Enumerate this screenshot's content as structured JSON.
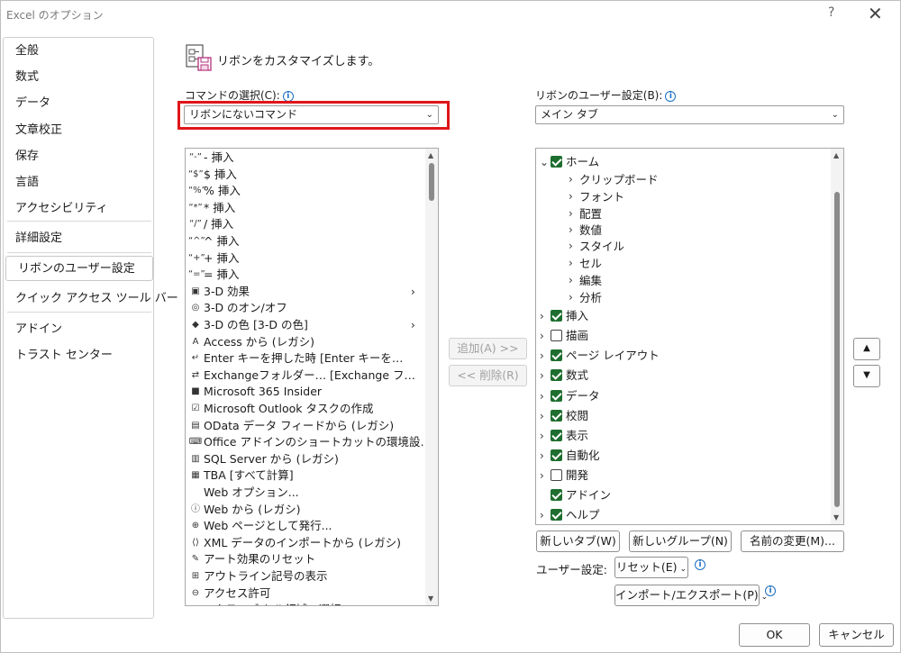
{
  "window": {
    "title": "Excel のオプション",
    "help": "?",
    "close": "✕"
  },
  "nav": {
    "items": [
      {
        "label": "全般"
      },
      {
        "label": "数式"
      },
      {
        "label": "データ"
      },
      {
        "label": "文章校正"
      },
      {
        "label": "保存"
      },
      {
        "label": "言語"
      },
      {
        "label": "アクセシビリティ"
      },
      {
        "label": "詳細設定"
      },
      {
        "label": "リボンのユーザー設定",
        "selected": true
      },
      {
        "label": "クイック アクセス ツール バー"
      },
      {
        "label": "アドイン"
      },
      {
        "label": "トラスト センター"
      }
    ]
  },
  "header": {
    "text": "リボンをカスタマイズします。"
  },
  "commands": {
    "label": "コマンドの選択(C):",
    "selected": "リボンにないコマンド",
    "items": [
      {
        "icon": "“-”",
        "label": "- 挿入"
      },
      {
        "icon": "“$”",
        "label": "$ 挿入"
      },
      {
        "icon": "“%”",
        "label": "% 挿入"
      },
      {
        "icon": "“*”",
        "label": "* 挿入"
      },
      {
        "icon": "“/”",
        "label": "/ 挿入"
      },
      {
        "icon": "“^”",
        "label": "^ 挿入"
      },
      {
        "icon": "“+”",
        "label": "+ 挿入"
      },
      {
        "icon": "“=”",
        "label": "= 挿入"
      },
      {
        "icon": "▣",
        "label": "3-D 効果",
        "submenu": true
      },
      {
        "icon": "◎",
        "label": "3-D のオン/オフ"
      },
      {
        "icon": "◆",
        "label": "3-D の色 [3-D の色]",
        "submenu": true
      },
      {
        "icon": "A",
        "label": "Access から (レガシ)"
      },
      {
        "icon": "↵",
        "label": "Enter キーを押した時 [Enter キーを…"
      },
      {
        "icon": "⇄",
        "label": "Exchangeフォルダー… [Exchange フ…"
      },
      {
        "icon": "■",
        "label": "Microsoft 365 Insider"
      },
      {
        "icon": "☑",
        "label": "Microsoft Outlook タスクの作成"
      },
      {
        "icon": "▤",
        "label": "OData データ フィードから (レガシ)"
      },
      {
        "icon": "⌨",
        "label": "Office アドインのショートカットの環境設…"
      },
      {
        "icon": "▥",
        "label": "SQL Server から (レガシ)"
      },
      {
        "icon": "▦",
        "label": "TBA [すべて計算]"
      },
      {
        "icon": "",
        "label": "Web オプション..."
      },
      {
        "icon": "ⓘ",
        "label": "Web から (レガシ)"
      },
      {
        "icon": "⊕",
        "label": "Web ページとして発行..."
      },
      {
        "icon": "⟨⟩",
        "label": "XML データのインポートから (レガシ)"
      },
      {
        "icon": "✎",
        "label": "アート効果のリセット"
      },
      {
        "icon": "⊞",
        "label": "アウトライン記号の表示"
      },
      {
        "icon": "⊖",
        "label": "アクセス許可"
      },
      {
        "icon": "▢",
        "label": "アクティブ セル領域の選択"
      }
    ]
  },
  "ribbon": {
    "label": "リボンのユーザー設定(B):",
    "selected": "メイン タブ",
    "tree": [
      {
        "label": "ホーム",
        "level": 0,
        "expanded": true,
        "checked": true,
        "hasCheckbox": true
      },
      {
        "label": "クリップボード",
        "level": 1,
        "expanded": false,
        "hasCheckbox": false
      },
      {
        "label": "フォント",
        "level": 1,
        "expanded": false,
        "hasCheckbox": false
      },
      {
        "label": "配置",
        "level": 1,
        "expanded": false,
        "hasCheckbox": false
      },
      {
        "label": "数値",
        "level": 1,
        "expanded": false,
        "hasCheckbox": false
      },
      {
        "label": "スタイル",
        "level": 1,
        "expanded": false,
        "hasCheckbox": false
      },
      {
        "label": "セル",
        "level": 1,
        "expanded": false,
        "hasCheckbox": false
      },
      {
        "label": "編集",
        "level": 1,
        "expanded": false,
        "hasCheckbox": false
      },
      {
        "label": "分析",
        "level": 1,
        "expanded": false,
        "hasCheckbox": false
      },
      {
        "label": "挿入",
        "level": 0,
        "expanded": false,
        "checked": true,
        "hasCheckbox": true
      },
      {
        "label": "描画",
        "level": 0,
        "expanded": false,
        "checked": false,
        "hasCheckbox": true
      },
      {
        "label": "ページ レイアウト",
        "level": 0,
        "expanded": false,
        "checked": true,
        "hasCheckbox": true
      },
      {
        "label": "数式",
        "level": 0,
        "expanded": false,
        "checked": true,
        "hasCheckbox": true
      },
      {
        "label": "データ",
        "level": 0,
        "expanded": false,
        "checked": true,
        "hasCheckbox": true
      },
      {
        "label": "校閲",
        "level": 0,
        "expanded": false,
        "checked": true,
        "hasCheckbox": true
      },
      {
        "label": "表示",
        "level": 0,
        "expanded": false,
        "checked": true,
        "hasCheckbox": true
      },
      {
        "label": "自動化",
        "level": 0,
        "expanded": false,
        "checked": true,
        "hasCheckbox": true
      },
      {
        "label": "開発",
        "level": 0,
        "expanded": false,
        "checked": false,
        "hasCheckbox": true
      },
      {
        "label": "アドイン",
        "level": 0,
        "expanded": null,
        "checked": true,
        "hasCheckbox": true
      },
      {
        "label": "ヘルプ",
        "level": 0,
        "expanded": false,
        "checked": true,
        "hasCheckbox": true
      }
    ]
  },
  "buttons": {
    "add": "追加(A) >>",
    "remove": "<< 削除(R)",
    "new_tab": "新しいタブ(W)",
    "new_group": "新しいグループ(N)",
    "rename": "名前の変更(M)...",
    "custom_label": "ユーザー設定:",
    "reset": "リセット(E)",
    "import_export": "インポート/エクスポート(P)",
    "ok": "OK",
    "cancel": "キャンセル",
    "move_up": "▲",
    "move_down": "▼"
  },
  "colors": {
    "check_green": "#1e6e2f",
    "highlight_red": "#e0151a",
    "info_blue": "#1b6ec2"
  }
}
